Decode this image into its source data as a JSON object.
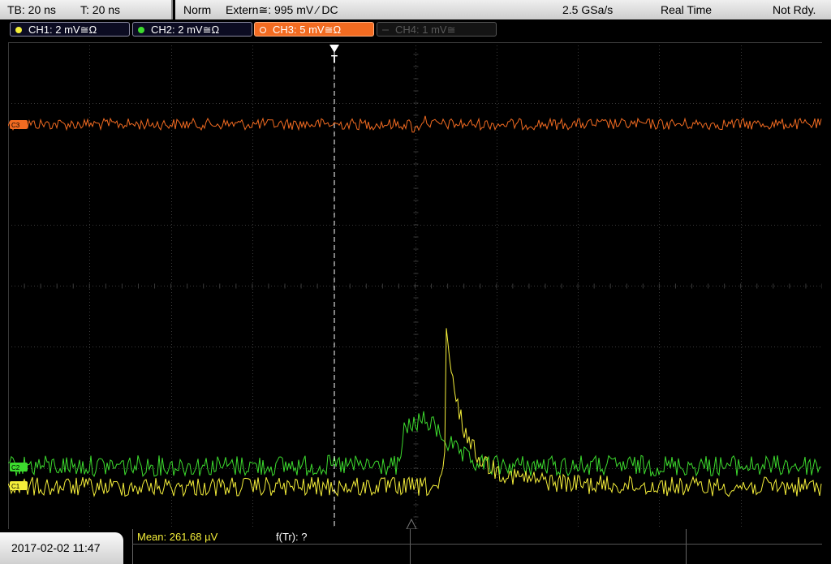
{
  "status": {
    "timebase": "TB: 20 ns",
    "trigger_time": "T: 20 ns",
    "trigger_mode": "Norm",
    "trigger_source": "Extern≅: 995 mV ⁄ DC",
    "sample_rate": "2.5 GSa/s",
    "acquisition": "Real Time",
    "ready_state": "Not Rdy."
  },
  "channels": [
    {
      "label": "CH1: 2 mV≅Ω",
      "color": "#f5ef3a"
    },
    {
      "label": "CH2: 2 mV≅Ω",
      "color": "#3ddc2e"
    },
    {
      "label": "CH3: 5 mV≅Ω",
      "color": "#f26b21"
    },
    {
      "label": "CH4: 1 mV≅",
      "color": "#555555"
    }
  ],
  "markers": {
    "trigger": "T",
    "ch3": "C3",
    "ch2": "C2",
    "ch1": "C1"
  },
  "measurements": {
    "mean": "Mean: 261.68 µV",
    "freq": "f(Tr): ?"
  },
  "datetime": "2017-02-02 11:47",
  "colors": {
    "grid": "#3a3a3a",
    "trigger_line": "#ffffff"
  }
}
